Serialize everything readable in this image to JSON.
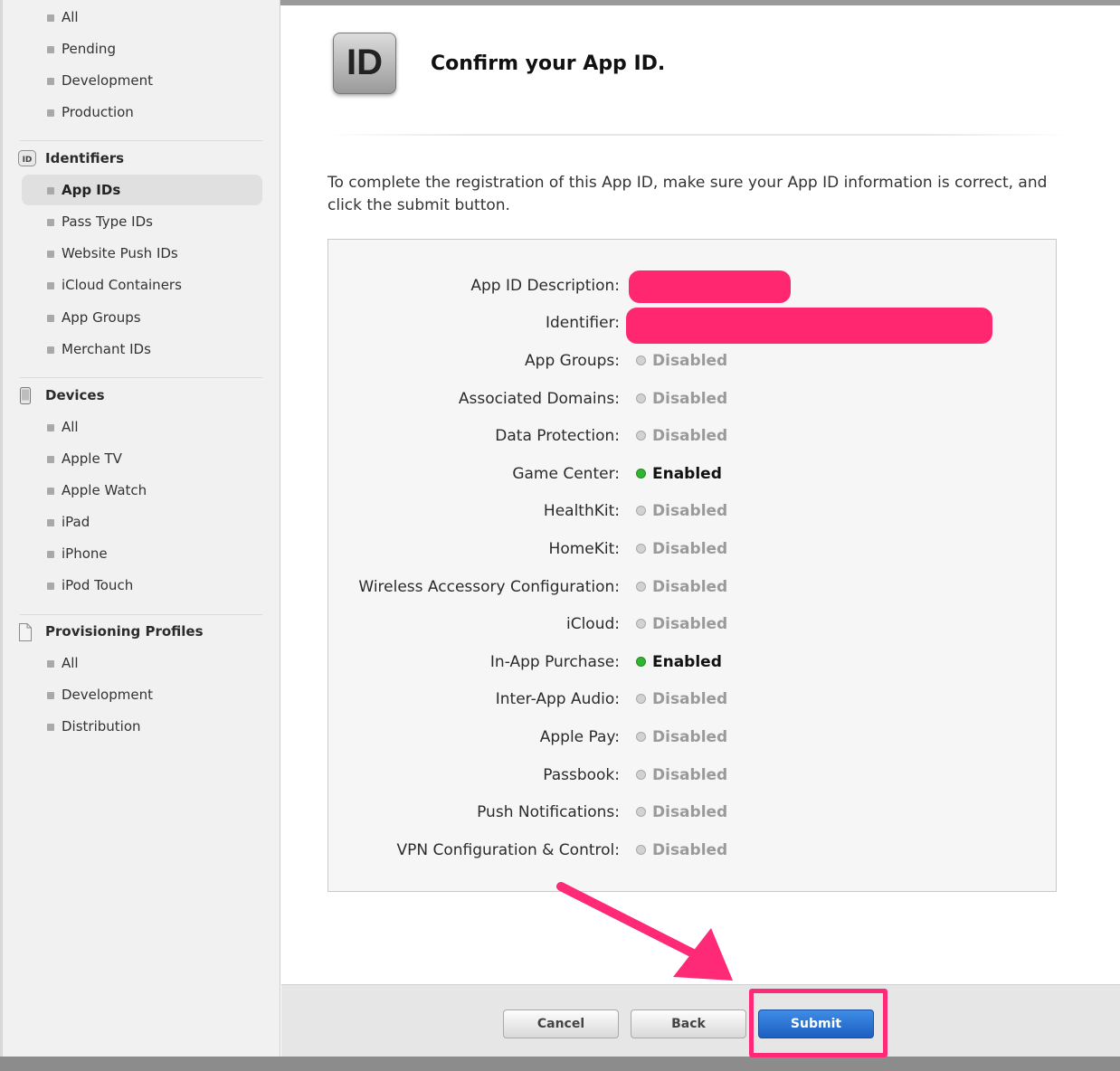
{
  "sidebar": {
    "certificates_items": [
      {
        "label": "All"
      },
      {
        "label": "Pending"
      },
      {
        "label": "Development"
      },
      {
        "label": "Production"
      }
    ],
    "identifiers": {
      "title": "Identifiers",
      "icon": "id-badge-icon",
      "items": [
        {
          "label": "App IDs",
          "active": true
        },
        {
          "label": "Pass Type IDs"
        },
        {
          "label": "Website Push IDs"
        },
        {
          "label": "iCloud Containers"
        },
        {
          "label": "App Groups"
        },
        {
          "label": "Merchant IDs"
        }
      ]
    },
    "devices": {
      "title": "Devices",
      "icon": "device-icon",
      "items": [
        {
          "label": "All"
        },
        {
          "label": "Apple TV"
        },
        {
          "label": "Apple Watch"
        },
        {
          "label": "iPad"
        },
        {
          "label": "iPhone"
        },
        {
          "label": "iPod Touch"
        }
      ]
    },
    "profiles": {
      "title": "Provisioning Profiles",
      "icon": "document-icon",
      "items": [
        {
          "label": "All"
        },
        {
          "label": "Development"
        },
        {
          "label": "Distribution"
        }
      ]
    }
  },
  "header": {
    "icon_text": "ID",
    "title": "Confirm your App ID."
  },
  "intro": "To complete the registration of this App ID, make sure your App ID information is correct, and click the submit button.",
  "details": {
    "redacted_rows": [
      {
        "label": "App ID Description:"
      },
      {
        "label": "Identifier:"
      }
    ],
    "services": [
      {
        "label": "App Groups:",
        "status": "Disabled",
        "enabled": false
      },
      {
        "label": "Associated Domains:",
        "status": "Disabled",
        "enabled": false
      },
      {
        "label": "Data Protection:",
        "status": "Disabled",
        "enabled": false
      },
      {
        "label": "Game Center:",
        "status": "Enabled",
        "enabled": true
      },
      {
        "label": "HealthKit:",
        "status": "Disabled",
        "enabled": false
      },
      {
        "label": "HomeKit:",
        "status": "Disabled",
        "enabled": false
      },
      {
        "label": "Wireless Accessory Configuration:",
        "status": "Disabled",
        "enabled": false
      },
      {
        "label": "iCloud:",
        "status": "Disabled",
        "enabled": false
      },
      {
        "label": "In-App Purchase:",
        "status": "Enabled",
        "enabled": true
      },
      {
        "label": "Inter-App Audio:",
        "status": "Disabled",
        "enabled": false
      },
      {
        "label": "Apple Pay:",
        "status": "Disabled",
        "enabled": false
      },
      {
        "label": "Passbook:",
        "status": "Disabled",
        "enabled": false
      },
      {
        "label": "Push Notifications:",
        "status": "Disabled",
        "enabled": false
      },
      {
        "label": "VPN Configuration & Control:",
        "status": "Disabled",
        "enabled": false
      }
    ]
  },
  "footer": {
    "cancel_label": "Cancel",
    "back_label": "Back",
    "submit_label": "Submit"
  },
  "colors": {
    "highlight": "#ff2a77",
    "submit_blue": "#1d5fc2",
    "enabled_green": "#34b233"
  }
}
